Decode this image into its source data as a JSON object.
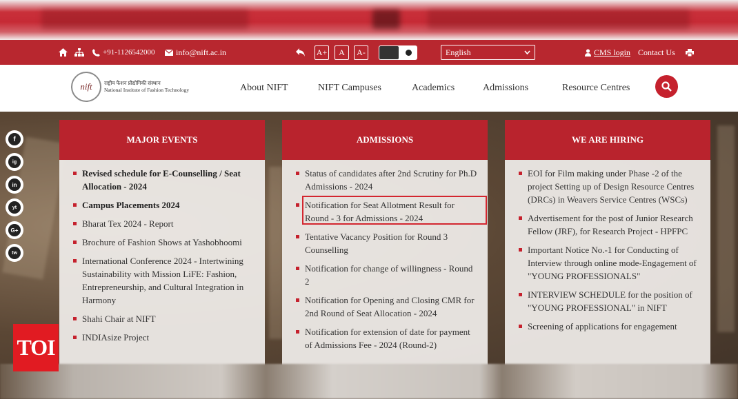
{
  "topbar": {
    "phone": "+91-1126542000",
    "email": "info@nift.ac.in",
    "font_increase": "A+",
    "font_normal": "A",
    "font_decrease": "A-",
    "language_selected": "English",
    "cms_login": "CMS login",
    "contact_us": "Contact Us"
  },
  "header": {
    "logo_mark": "nift",
    "logo_hindi": "राष्ट्रीय फैशन प्रौद्योगिकी संस्थान",
    "logo_english": "National Institute of Fashion Technology",
    "nav": [
      "About NIFT",
      "NIFT Campuses",
      "Academics",
      "Admissions",
      "Resource Centres"
    ]
  },
  "social": [
    "f",
    "ig",
    "in",
    "yt",
    "G+",
    "tw"
  ],
  "panels": {
    "major_events": {
      "title": "MAJOR EVENTS",
      "items": [
        "Revised schedule for E-Counselling / Seat Allocation - 2024",
        "Campus Placements 2024",
        "Bharat Tex 2024 - Report",
        "Brochure of Fashion Shows at Yashobhoomi",
        "International Conference 2024 - Intertwining Sustainability with Mission LiFE: Fashion, Entrepreneurship, and Cultural Integration in Harmony",
        "Shahi Chair at NIFT",
        "INDIAsize Project"
      ]
    },
    "admissions": {
      "title": "ADMISSIONS",
      "items": [
        "Status of candidates after 2nd Scrutiny for Ph.D Admissions - 2024",
        "Notification for Seat Allotment Result for Round - 3 for Admissions - 2024",
        "Tentative Vacancy Position for Round 3 Counselling",
        "Notification for change of willingness - Round 2",
        "Notification for Opening and Closing CMR for 2nd Round of Seat Allocation - 2024",
        "Notification for extension of date for payment of Admissions Fee - 2024 (Round-2)"
      ]
    },
    "hiring": {
      "title": "WE ARE HIRING",
      "items": [
        "EOI for Film making under Phase -2 of the project Setting up of Design Resource Centres (DRCs) in Weavers Service Centres (WSCs)",
        "Advertisement for the post of Junior Research Fellow (JRF), for Research Project - HPFPC",
        "Important Notice No.-1 for Conducting of Interview through online mode-Engagement of \"YOUNG PROFESSIONALS\"",
        "INTERVIEW SCHEDULE for the position of \"YOUNG PROFESSIONAL\" in NIFT",
        "Screening of applications for engagement"
      ]
    }
  },
  "watermark": "TOI"
}
